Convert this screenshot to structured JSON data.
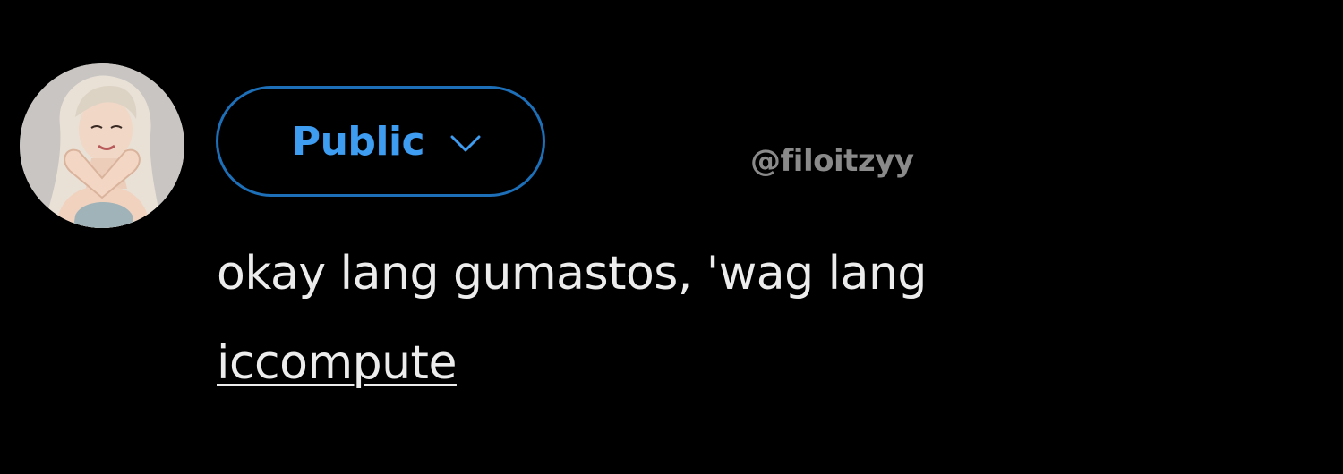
{
  "composer": {
    "avatar_icon": "user-avatar-photo",
    "audience": {
      "label": "Public",
      "icon": "chevron-down-icon",
      "accent_color": "#1d9bf0"
    },
    "text_lines": [
      "okay lang gumastos, 'wag lang",
      "iccompute"
    ]
  },
  "watermark": {
    "text": "@filoitzyy"
  }
}
